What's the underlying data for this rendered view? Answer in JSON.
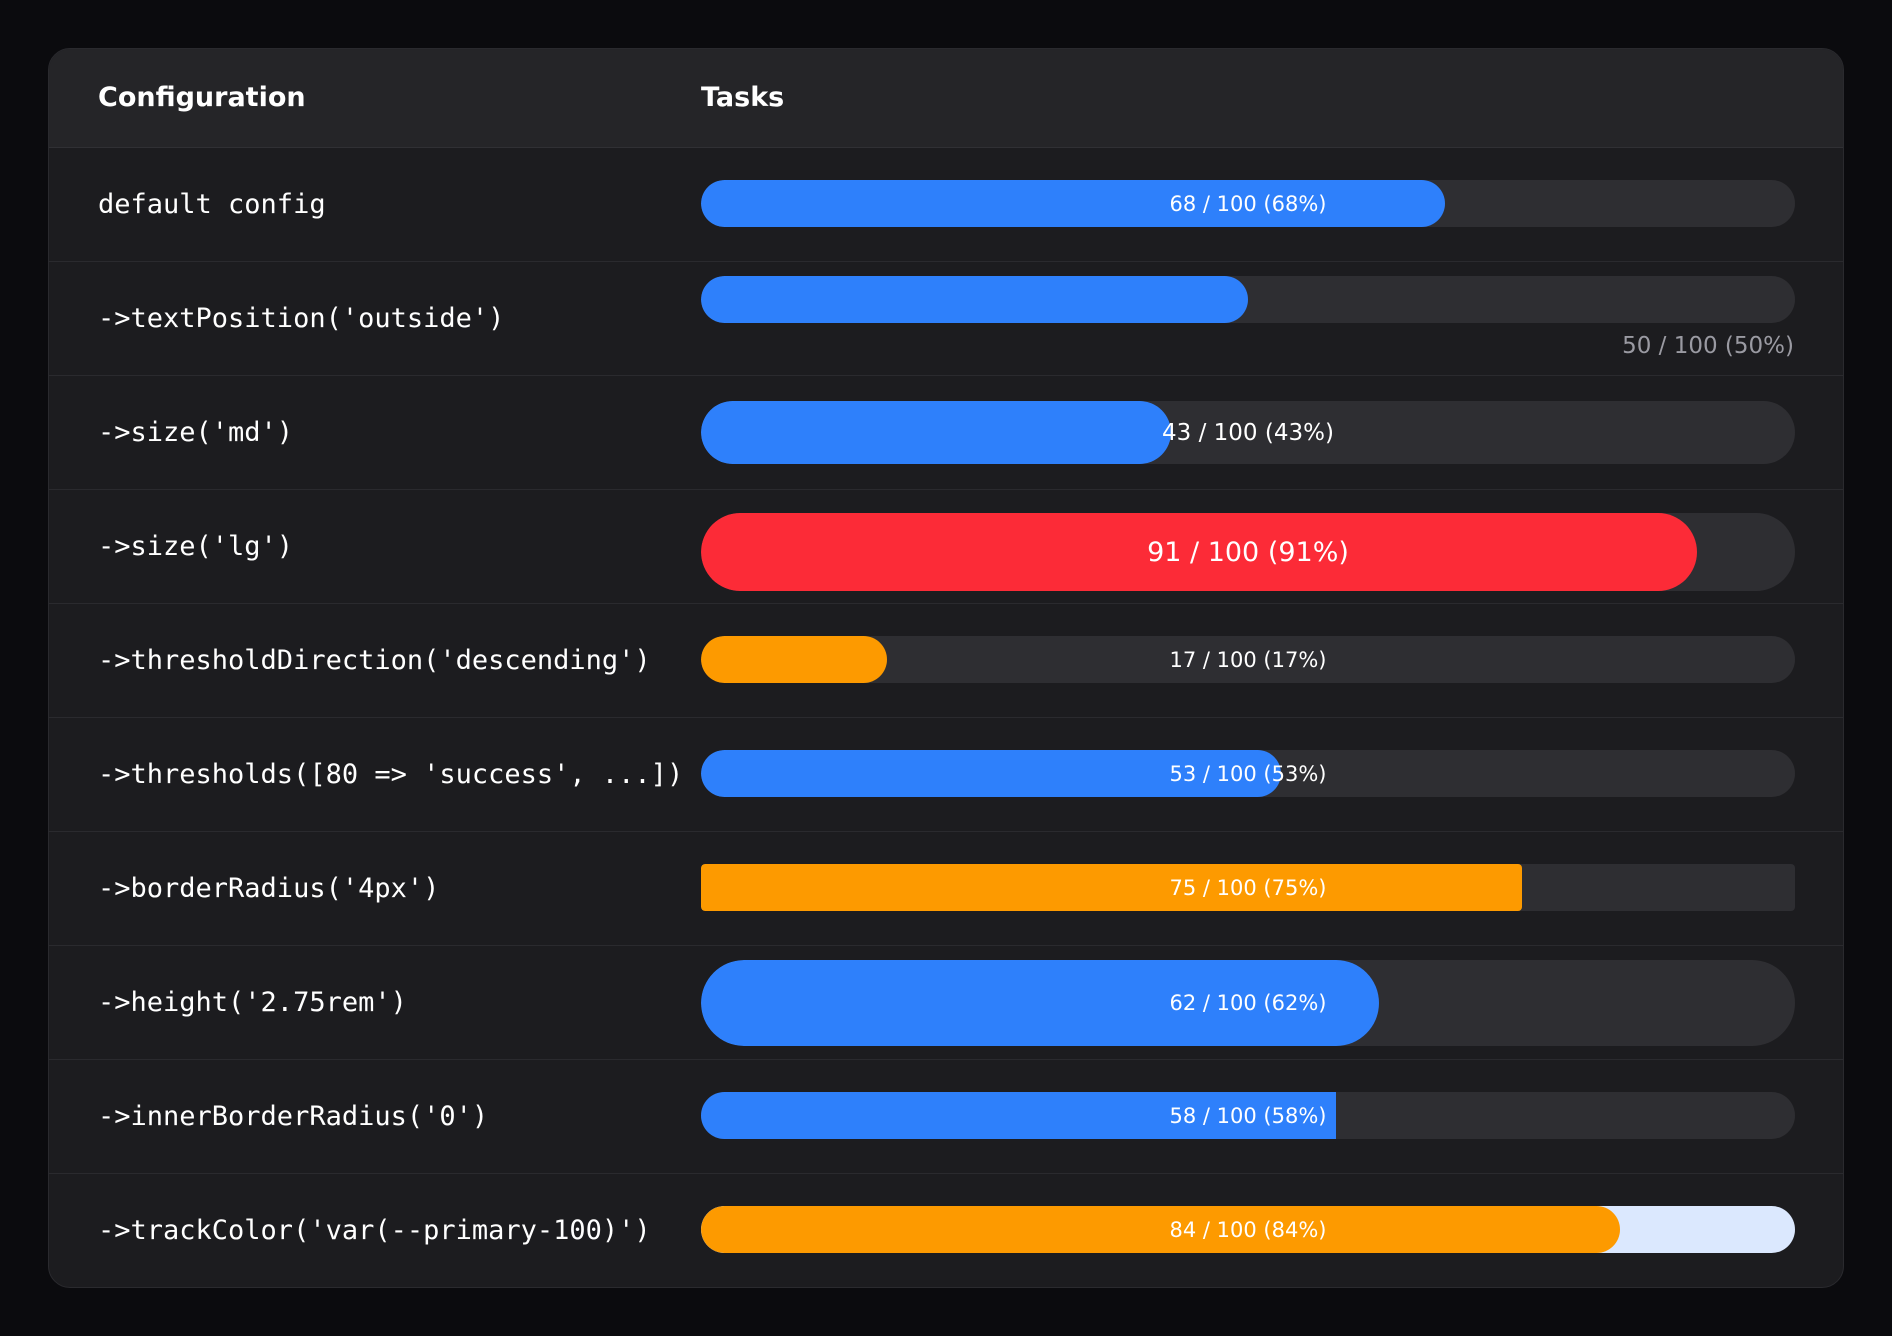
{
  "header": {
    "configuration": "Configuration",
    "tasks": "Tasks"
  },
  "colors": {
    "primary": "#2e80fb",
    "danger": "#fc2b37",
    "warning": "#fd9a00",
    "track": "#2e2e32",
    "track_primary_100": "#dbe8fe"
  },
  "rows": [
    {
      "config": "default config",
      "value": 68,
      "max": 100,
      "label": "68 / 100 (68%)",
      "color": "#2e80fb",
      "size": "default",
      "text_position": "inside",
      "shape": "pill",
      "track_color": "#2e2e32"
    },
    {
      "config": "->textPosition('outside')",
      "value": 50,
      "max": 100,
      "label": "50 / 100 (50%)",
      "color": "#2e80fb",
      "size": "default",
      "text_position": "outside",
      "shape": "pill",
      "track_color": "#2e2e32"
    },
    {
      "config": "->size('md')",
      "value": 43,
      "max": 100,
      "label": "43 / 100 (43%)",
      "color": "#2e80fb",
      "size": "md",
      "text_position": "inside",
      "shape": "pill",
      "track_color": "#2e2e32"
    },
    {
      "config": "->size('lg')",
      "value": 91,
      "max": 100,
      "label": "91 / 100 (91%)",
      "color": "#fc2b37",
      "size": "lg",
      "text_position": "inside",
      "shape": "pill",
      "track_color": "#2e2e32"
    },
    {
      "config": "->thresholdDirection('descending')",
      "value": 17,
      "max": 100,
      "label": "17 / 100 (17%)",
      "color": "#fd9a00",
      "size": "default",
      "text_position": "inside",
      "shape": "pill",
      "track_color": "#2e2e32"
    },
    {
      "config": "->thresholds([80 => 'success', ...])",
      "value": 53,
      "max": 100,
      "label": "53 / 100 (53%)",
      "color": "#2e80fb",
      "size": "default",
      "text_position": "inside",
      "shape": "pill",
      "track_color": "#2e2e32"
    },
    {
      "config": "->borderRadius('4px')",
      "value": 75,
      "max": 100,
      "label": "75 / 100 (75%)",
      "color": "#fd9a00",
      "size": "default",
      "text_position": "inside",
      "shape": "radius-4px",
      "track_color": "#2e2e32"
    },
    {
      "config": "->height('2.75rem')",
      "value": 62,
      "max": 100,
      "label": "62 / 100 (62%)",
      "color": "#2e80fb",
      "size": "tall",
      "text_position": "inside",
      "shape": "pill",
      "track_color": "#2e2e32"
    },
    {
      "config": "->innerBorderRadius('0')",
      "value": 58,
      "max": 100,
      "label": "58 / 100 (58%)",
      "color": "#2e80fb",
      "size": "default",
      "text_position": "inside",
      "shape": "inner-square",
      "track_color": "#2e2e32"
    },
    {
      "config": "->trackColor('var(--primary-100)')",
      "value": 84,
      "max": 100,
      "label": "84 / 100 (84%)",
      "color": "#fd9a00",
      "size": "default",
      "text_position": "inside",
      "shape": "pill",
      "track_color": "#dbe8fe"
    }
  ]
}
